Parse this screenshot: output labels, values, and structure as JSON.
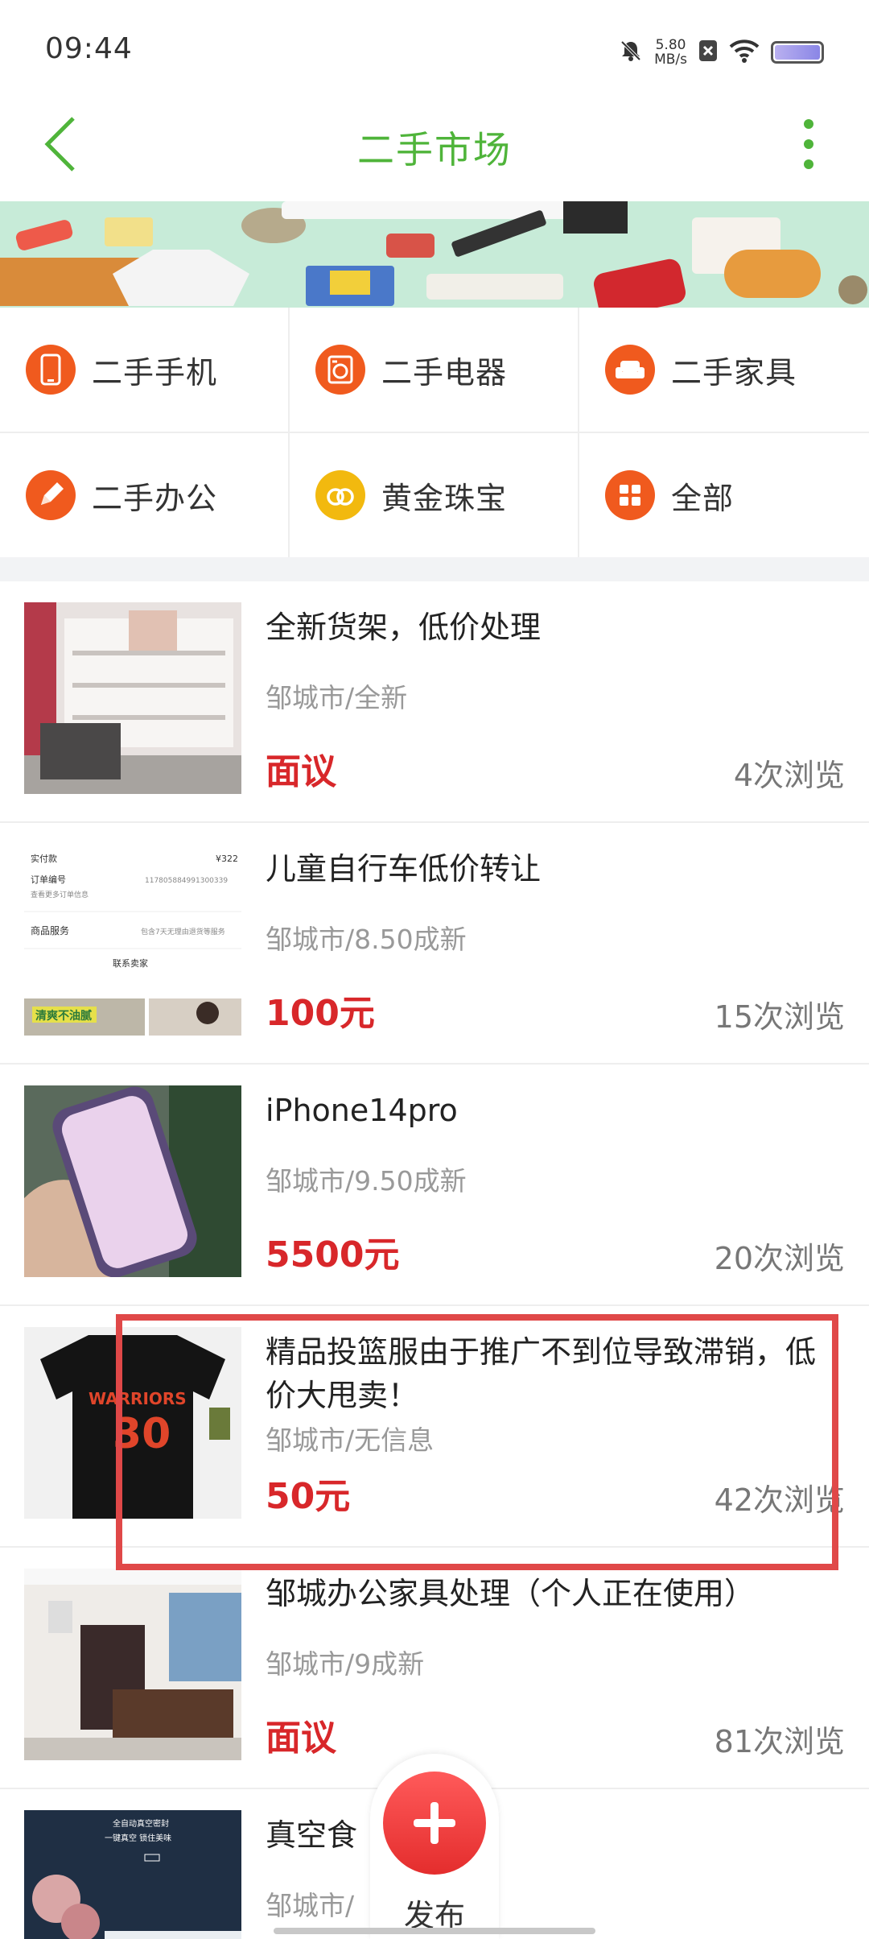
{
  "status_bar": {
    "time": "09:44",
    "net_speed_value": "5.80",
    "net_speed_unit": "MB/s"
  },
  "header": {
    "title": "二手市场",
    "title_color": "#4fb43a"
  },
  "categories": [
    {
      "label": "二手手机",
      "icon": "phone-icon",
      "color": "#f05a1e"
    },
    {
      "label": "二手电器",
      "icon": "washer-icon",
      "color": "#f05a1e"
    },
    {
      "label": "二手家具",
      "icon": "sofa-icon",
      "color": "#f05a1e"
    },
    {
      "label": "二手办公",
      "icon": "pencil-icon",
      "color": "#f05a1e"
    },
    {
      "label": "黄金珠宝",
      "icon": "rings-icon",
      "color": "#f2b90f"
    },
    {
      "label": "全部",
      "icon": "grid-icon",
      "color": "#f05a1e"
    }
  ],
  "listings": [
    {
      "title": "全新货架，低价处理",
      "meta": "邹城市/全新",
      "price": "面议",
      "views": "4次浏览"
    },
    {
      "title": "儿童自行车低价转让",
      "meta": "邹城市/8.50成新",
      "price": "100元",
      "views": "15次浏览",
      "thumb": {
        "field1": "实付款",
        "amount": "¥322",
        "field2": "订单编号",
        "order_no": "117805884991300339",
        "more": "查看更多订单信息",
        "service": "商品服务",
        "service_note": "包含7天无理由退货等服务",
        "contact": "联系卖家",
        "ad": "清爽不油腻"
      }
    },
    {
      "title": "iPhone14pro",
      "meta": "邹城市/9.50成新",
      "price": "5500元",
      "views": "20次浏览"
    },
    {
      "title": "精品投篮服由于推广不到位导致滞销，低价大甩卖！",
      "meta": "邹城市/无信息",
      "price": "50元",
      "views": "42次浏览",
      "thumb": {
        "jersey_text": "WARRIORS",
        "jersey_number": "30"
      }
    },
    {
      "title": "邹城办公家具处理（个人正在使用）",
      "meta": "邹城市/9成新",
      "price": "面议",
      "views": "81次浏览"
    },
    {
      "title": "真空食",
      "meta": "邹城市/",
      "price": "",
      "views": "",
      "thumb": {
        "line1": "全自动真空密封",
        "line2": "一键真空 锁住美味"
      }
    }
  ],
  "fab": {
    "label": "发布"
  },
  "colors": {
    "price": "#d8272a",
    "accent": "#4fb43a",
    "highlight": "#e04848"
  }
}
